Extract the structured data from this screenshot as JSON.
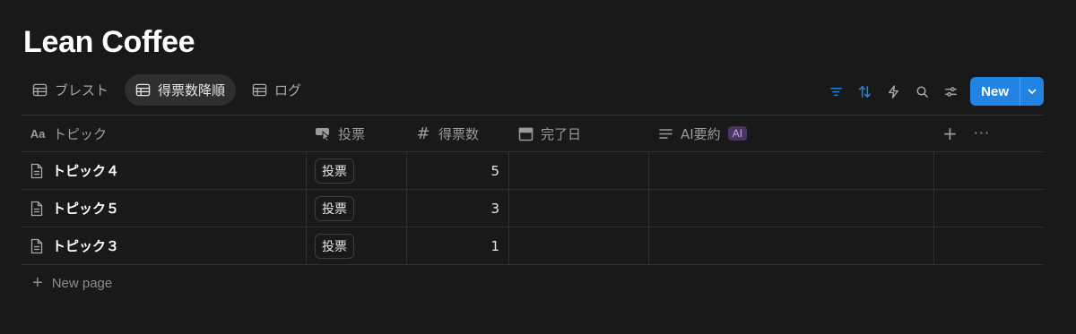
{
  "page": {
    "title": "Lean Coffee"
  },
  "views": [
    {
      "label": "ブレスト",
      "icon": "table-icon",
      "active": false
    },
    {
      "label": "得票数降順",
      "icon": "table-icon",
      "active": true
    },
    {
      "label": "ログ",
      "icon": "table-icon",
      "active": false
    }
  ],
  "toolbar": {
    "icons": [
      "filter-icon",
      "sort-icon",
      "automation-icon",
      "search-icon",
      "settings-icon"
    ],
    "new_label": "New",
    "accent": "#2383e2"
  },
  "table": {
    "columns": [
      {
        "label": "トピック",
        "icon": "text-type-icon"
      },
      {
        "label": "投票",
        "icon": "button-icon"
      },
      {
        "label": "得票数",
        "icon": "number-icon"
      },
      {
        "label": "完了日",
        "icon": "calendar-icon"
      },
      {
        "label": "AI要約",
        "icon": "text-lines-icon",
        "badge": "AI"
      }
    ],
    "rows": [
      {
        "topic": "トピック４",
        "vote_button": "投票",
        "votes": "5",
        "done_date": "",
        "ai_summary": ""
      },
      {
        "topic": "トピック５",
        "vote_button": "投票",
        "votes": "3",
        "done_date": "",
        "ai_summary": ""
      },
      {
        "topic": "トピック３",
        "vote_button": "投票",
        "votes": "1",
        "done_date": "",
        "ai_summary": ""
      }
    ],
    "new_page_label": "New page"
  }
}
